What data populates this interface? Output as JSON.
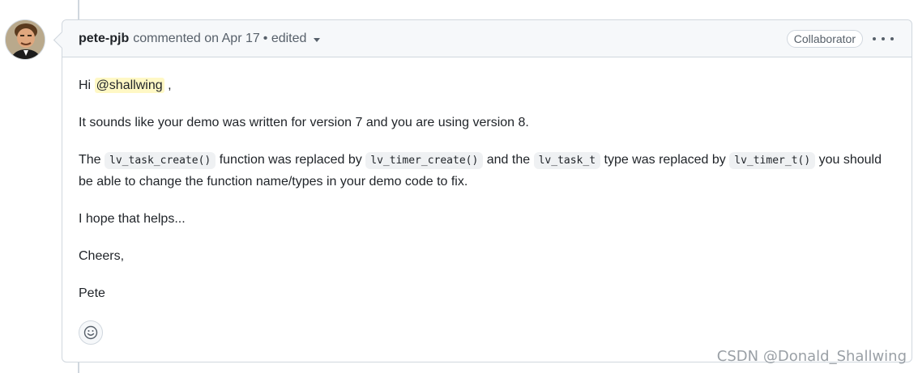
{
  "comment": {
    "author": "pete-pjb",
    "meta": "commented on Apr 17",
    "edited_label": "• edited",
    "badge": "Collaborator",
    "menu_icon": "kebab-horizontal-icon",
    "paragraphs": {
      "greeting_prefix": "Hi ",
      "greeting_mention": "@shallwing",
      "greeting_suffix": " ,",
      "p2": "It sounds like your demo was written for version 7 and you are using version 8.",
      "p3_a": "The ",
      "p3_code1": "lv_task_create()",
      "p3_b": " function was replaced by ",
      "p3_code2": "lv_timer_create()",
      "p3_c": " and the ",
      "p3_code3": "lv_task_t",
      "p3_d": " type was replaced by ",
      "p3_code4": "lv_timer_t()",
      "p3_e": " you should be able to change the function name/types in your demo code to fix.",
      "p4": "I hope that helps...",
      "p5": "Cheers,",
      "p6": "Pete"
    },
    "reaction_icon": "smiley-icon"
  },
  "watermark": "CSDN @Donald_Shallwing",
  "colors": {
    "border": "#d0d7de",
    "header_bg": "#f6f8fa",
    "mention_bg": "#fff8c5",
    "muted_text": "#57606a"
  }
}
